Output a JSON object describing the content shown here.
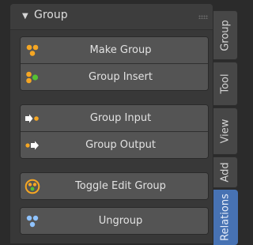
{
  "panel": {
    "title": "Group",
    "expanded": true
  },
  "buttons": [
    {
      "label": "Make Group",
      "icon": "make-group-icon"
    },
    {
      "label": "Group Insert",
      "icon": "group-insert-icon"
    },
    {
      "label": "Group Input",
      "icon": "group-input-icon"
    },
    {
      "label": "Group Output",
      "icon": "group-output-icon"
    },
    {
      "label": "Toggle Edit Group",
      "icon": "toggle-edit-group-icon"
    },
    {
      "label": "Ungroup",
      "icon": "ungroup-icon"
    }
  ],
  "tabs": [
    {
      "label": "Group",
      "active": false
    },
    {
      "label": "Tool",
      "active": false
    },
    {
      "label": "View",
      "active": false
    },
    {
      "label": "Add",
      "active": false
    },
    {
      "label": "Relations",
      "active": true
    }
  ],
  "colors": {
    "panel_bg": "#383838",
    "button_bg": "#545454",
    "tab_active": "#4772b3",
    "icon_orange": "#f5a623",
    "icon_green": "#55c232",
    "icon_blue": "#8fc3ff"
  }
}
